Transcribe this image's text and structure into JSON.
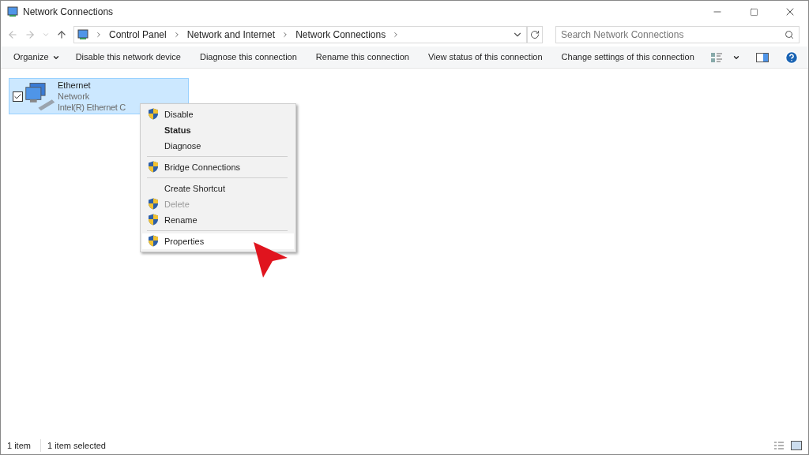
{
  "window": {
    "title": "Network Connections"
  },
  "address_bar": {
    "crumbs": [
      "Control Panel",
      "Network and Internet",
      "Network Connections"
    ]
  },
  "search": {
    "placeholder": "Search Network Connections"
  },
  "toolbar": {
    "organize": "Organize",
    "actions": [
      "Disable this network device",
      "Diagnose this connection",
      "Rename this connection",
      "View status of this connection",
      "Change settings of this connection"
    ]
  },
  "item": {
    "name": "Ethernet",
    "status": "Network",
    "device": "Intel(R) Ethernet C",
    "checked": true,
    "selected": true
  },
  "context_menu": {
    "groups": [
      [
        {
          "label": "Disable",
          "shield": true,
          "bold": false,
          "disabled": false,
          "selected": false
        },
        {
          "label": "Status",
          "shield": false,
          "bold": true,
          "disabled": false,
          "selected": false
        },
        {
          "label": "Diagnose",
          "shield": false,
          "bold": false,
          "disabled": false,
          "selected": false
        }
      ],
      [
        {
          "label": "Bridge Connections",
          "shield": true,
          "bold": false,
          "disabled": false,
          "selected": false
        }
      ],
      [
        {
          "label": "Create Shortcut",
          "shield": false,
          "bold": false,
          "disabled": false,
          "selected": false
        },
        {
          "label": "Delete",
          "shield": true,
          "bold": false,
          "disabled": true,
          "selected": false
        },
        {
          "label": "Rename",
          "shield": true,
          "bold": false,
          "disabled": false,
          "selected": false
        }
      ],
      [
        {
          "label": "Properties",
          "shield": true,
          "bold": false,
          "disabled": false,
          "selected": true
        }
      ]
    ]
  },
  "status_bar": {
    "count": "1 item",
    "selection": "1 item selected"
  }
}
